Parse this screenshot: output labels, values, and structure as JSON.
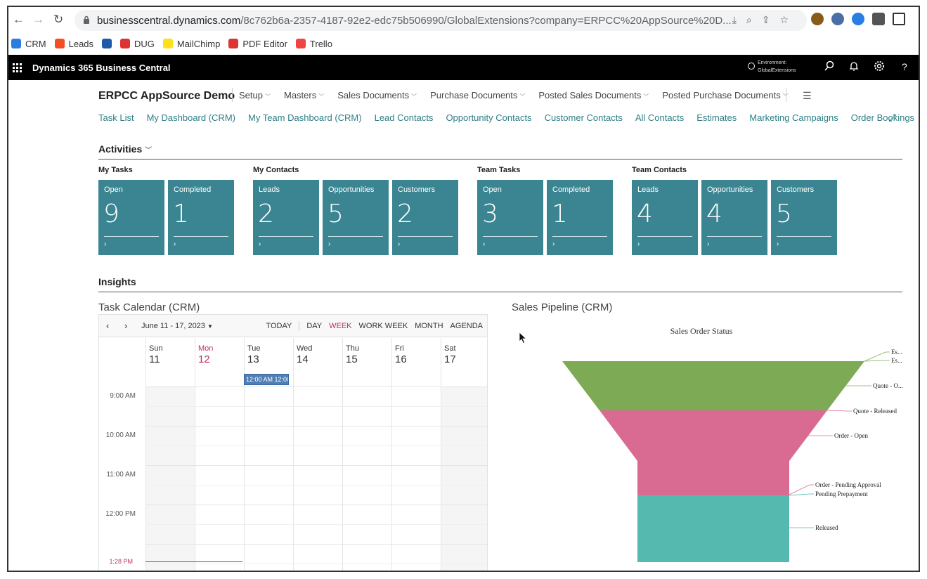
{
  "browser": {
    "url_host": "businesscentral.dynamics.com",
    "url_path": "/8c762b6a-2357-4187-92e2-edc75b506990/GlobalExtensions?company=ERPCC%20AppSource%20D...",
    "bookmarks": [
      {
        "label": "CRM",
        "color": "#2a7de1"
      },
      {
        "label": "Leads",
        "color": "#f25022"
      },
      {
        "label": "",
        "color": "#1e5aa8"
      },
      {
        "label": "DUG",
        "color": "#d33"
      },
      {
        "label": "MailChimp",
        "color": "#ffe01b"
      },
      {
        "label": "PDF Editor",
        "color": "#d33"
      },
      {
        "label": "Trello",
        "color": "#e44"
      }
    ]
  },
  "appbar": {
    "title": "Dynamics 365 Business Central",
    "env_label": "Environment:",
    "env_name": "GlobalExtensions",
    "help": "?"
  },
  "page": {
    "company": "ERPCC AppSource Demo",
    "menu": [
      "Setup",
      "Masters",
      "Sales Documents",
      "Purchase Documents",
      "Posted Sales Documents",
      "Posted Purchase Documents"
    ],
    "navlinks": [
      "Task List",
      "My Dashboard (CRM)",
      "My Team Dashboard (CRM)",
      "Lead Contacts",
      "Opportunity Contacts",
      "Customer Contacts",
      "All Contacts",
      "Estimates",
      "Marketing Campaigns",
      "Order Bookings"
    ]
  },
  "activities": {
    "title": "Activities",
    "groups": [
      {
        "label": "My Tasks",
        "tiles": [
          {
            "label": "Open",
            "value": "9"
          },
          {
            "label": "Completed",
            "value": "1"
          }
        ]
      },
      {
        "label": "My Contacts",
        "tiles": [
          {
            "label": "Leads",
            "value": "2"
          },
          {
            "label": "Opportunities",
            "value": "5"
          },
          {
            "label": "Customers",
            "value": "2"
          }
        ]
      },
      {
        "label": "Team Tasks",
        "tiles": [
          {
            "label": "Open",
            "value": "3"
          },
          {
            "label": "Completed",
            "value": "1"
          }
        ]
      },
      {
        "label": "Team Contacts",
        "tiles": [
          {
            "label": "Leads",
            "value": "4"
          },
          {
            "label": "Opportunities",
            "value": "4"
          },
          {
            "label": "Customers",
            "value": "5"
          }
        ]
      }
    ],
    "tile_color": "#3b8592"
  },
  "insights": {
    "title": "Insights",
    "calendar": {
      "title": "Task Calendar (CRM)",
      "range": "June 11 - 17, 2023",
      "today_btn": "TODAY",
      "views": [
        "DAY",
        "WEEK",
        "WORK WEEK",
        "MONTH",
        "AGENDA"
      ],
      "active_view": "WEEK",
      "days": [
        {
          "name": "Sun",
          "num": "11"
        },
        {
          "name": "Mon",
          "num": "12"
        },
        {
          "name": "Tue",
          "num": "13"
        },
        {
          "name": "Wed",
          "num": "14"
        },
        {
          "name": "Thu",
          "num": "15"
        },
        {
          "name": "Fri",
          "num": "16"
        },
        {
          "name": "Sat",
          "num": "17"
        }
      ],
      "times": [
        "9:00 AM",
        "10:00 AM",
        "11:00 AM",
        "12:00 PM"
      ],
      "event": "12:00 AM 12:00",
      "now_label": "1:28 PM"
    },
    "pipeline": {
      "title": "Sales Pipeline (CRM)",
      "chart_data": {
        "type": "funnel",
        "title": "Sales Order Status",
        "stages": [
          {
            "name": "Es...",
            "value": 0,
            "color": "#7dab55"
          },
          {
            "name": "Es...",
            "value": 0,
            "color": "#7dab55"
          },
          {
            "name": "Quote - O...",
            "value": 1,
            "color": "#7dab55"
          },
          {
            "name": "Quote - Released",
            "value": 0,
            "color": "#d96b93"
          },
          {
            "name": "Order - Open",
            "value": 1,
            "color": "#d96b93"
          },
          {
            "name": "Order - Pending Approval",
            "value": 0,
            "color": "#d96b93"
          },
          {
            "name": "Pending Prepayment",
            "value": 0,
            "color": "#56b9b0"
          },
          {
            "name": "Released",
            "value": 1,
            "color": "#56b9b0"
          }
        ]
      }
    }
  }
}
